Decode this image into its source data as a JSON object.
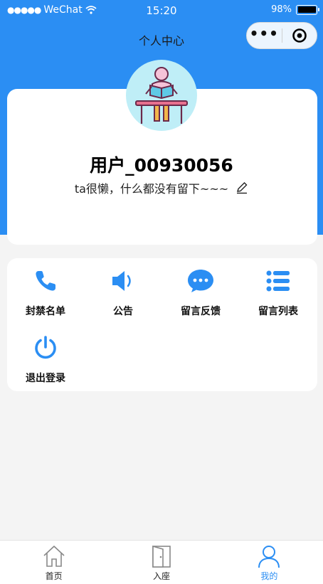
{
  "status_bar": {
    "signal": "●●●●●",
    "carrier": "WeChat",
    "time": "15:20",
    "battery": "98%"
  },
  "nav": {
    "title": "个人中心",
    "more": "•••"
  },
  "profile": {
    "username": "用户_00930056",
    "signature": "ta很懒，什么都没有留下~~~"
  },
  "menu": {
    "items": [
      {
        "label": "封禁名单",
        "icon": "phone-icon"
      },
      {
        "label": "公告",
        "icon": "speaker-icon"
      },
      {
        "label": "留言反馈",
        "icon": "chat-bubble-icon"
      },
      {
        "label": "留言列表",
        "icon": "list-icon"
      },
      {
        "label": "退出登录",
        "icon": "power-icon"
      }
    ]
  },
  "tabbar": {
    "tabs": [
      {
        "label": "首页",
        "icon": "home-icon"
      },
      {
        "label": "入座",
        "icon": "door-icon"
      },
      {
        "label": "我的",
        "icon": "user-icon"
      }
    ],
    "active": "我的"
  },
  "colors": {
    "primary": "#2b8ef3",
    "page_bg": "#f4f4f4",
    "card_bg": "#ffffff",
    "avatar_bg": "#bfeef7"
  }
}
